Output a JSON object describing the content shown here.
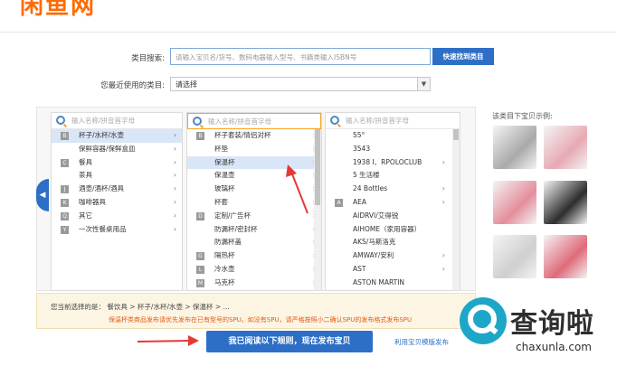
{
  "header": {
    "logo_text": "闲鱼网"
  },
  "form": {
    "search_label": "类目搜索:",
    "search_placeholder": "请输入宝贝名/货号、数码电器输入型号、书籍类输入ISBN号",
    "search_button": "快速找到类目",
    "recent_label": "您最近使用的类目:",
    "recent_value": "请选择"
  },
  "columns": {
    "col1": {
      "placeholder": "输入名称/拼音首字母",
      "items": [
        {
          "letter": "B",
          "label": "杯子/水杯/水壶",
          "selected": true
        },
        {
          "letter": "",
          "label": "保鲜容器/保鲜盒皿",
          "selected": false
        },
        {
          "letter": "C",
          "label": "餐具",
          "selected": false
        },
        {
          "letter": "",
          "label": "茶具",
          "selected": false
        },
        {
          "letter": "J",
          "label": "酒壶/酒杯/酒具",
          "selected": false
        },
        {
          "letter": "K",
          "label": "咖啡器具",
          "selected": false
        },
        {
          "letter": "Q",
          "label": "其它",
          "selected": false
        },
        {
          "letter": "Y",
          "label": "一次性餐桌用品",
          "selected": false
        }
      ]
    },
    "col2": {
      "placeholder": "输入名称/拼音首字母",
      "items": [
        {
          "letter": "B",
          "label": "杯子套装/情侣对杯",
          "selected": false
        },
        {
          "letter": "",
          "label": "杯垫",
          "selected": false
        },
        {
          "letter": "",
          "label": "保温杯",
          "selected": true
        },
        {
          "letter": "",
          "label": "保温壶",
          "selected": false
        },
        {
          "letter": "",
          "label": "玻璃杯",
          "selected": false
        },
        {
          "letter": "",
          "label": "杯套",
          "selected": false
        },
        {
          "letter": "D",
          "label": "定制/广告杯",
          "selected": false
        },
        {
          "letter": "",
          "label": "防漏杯/密封杯",
          "selected": false
        },
        {
          "letter": "",
          "label": "防漏杯盖",
          "selected": false
        },
        {
          "letter": "G",
          "label": "隔热杯",
          "selected": false
        },
        {
          "letter": "L",
          "label": "冷水壶",
          "selected": false
        },
        {
          "letter": "M",
          "label": "马克杯",
          "selected": false
        }
      ]
    },
    "col3": {
      "placeholder": "输入名称/拼音首字母",
      "items": [
        {
          "label": "55°",
          "chev": false
        },
        {
          "label": "3543",
          "chev": false
        },
        {
          "label": "1938 I、RPOLOCLUB",
          "chev": true
        },
        {
          "label": "5 生活楼",
          "chev": false
        },
        {
          "label": "24 Bottles",
          "chev": true
        },
        {
          "letter": "A",
          "label": "AEA",
          "chev": true
        },
        {
          "label": "AIDRVI/艾得锐",
          "chev": false
        },
        {
          "label": "AIHOME（家用容器）",
          "chev": false
        },
        {
          "label": "AKS/马斯洛克",
          "chev": false
        },
        {
          "label": "AMWAY/安利",
          "chev": true
        },
        {
          "label": "AST",
          "chev": true
        },
        {
          "label": "ASTON MARTIN",
          "chev": false
        }
      ]
    }
  },
  "samples": {
    "title": "该类目下宝贝示例:",
    "colors": [
      "#a9a9a9",
      "#e7a9b3",
      "#e48e9c",
      "#2d2d2d",
      "#cfcfcf",
      "#e06a7a"
    ]
  },
  "selection": {
    "path": "您当前选择的是：  餐饮具 > 杯子/水杯/水壶 > 保温杯 > ...",
    "note": "保温杯类商品发布请优先发布在已有型号的SPU。如没有SPU，请严格按照小二确认SPU的发布格式发布SPU"
  },
  "actions": {
    "submit": "我已阅读以下规则，现在发布宝贝",
    "template_link": "利用宝贝模版发布"
  },
  "watermark": {
    "text": "查询啦",
    "url": "chaxunla.com"
  }
}
